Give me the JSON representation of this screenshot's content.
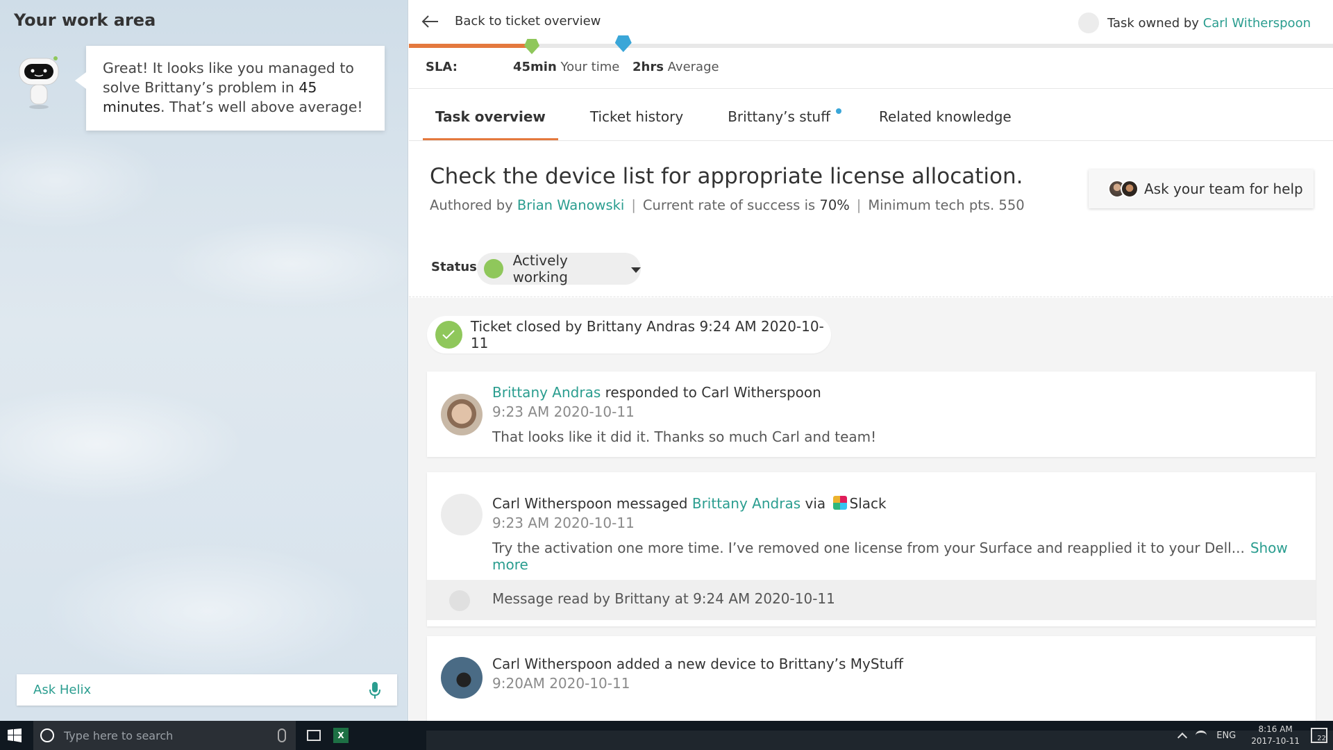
{
  "left": {
    "title": "Your work area",
    "bubble": {
      "pre": "Great! It looks like you managed to solve Brittany’s problem in ",
      "bold": "45 minutes",
      "post": ". That’s well above average!"
    },
    "ask_placeholder": "Ask Helix"
  },
  "topbar": {
    "back_label": "Back to ticket overview",
    "owner_prefix": "Task owned by",
    "owner_name": "Carl Witherspoon"
  },
  "sla": {
    "label": "SLA:",
    "your_value": "45min",
    "your_label": "Your time",
    "avg_value": "2hrs",
    "avg_label": "Average",
    "your_fraction": 0.133,
    "avg_fraction": 0.232
  },
  "tabs": [
    {
      "label": "Task overview",
      "active": true
    },
    {
      "label": "Ticket history"
    },
    {
      "label": "Brittany’s stuff",
      "has_dot": true
    },
    {
      "label": "Related knowledge"
    }
  ],
  "task": {
    "title": "Check the device list for appropriate license allocation.",
    "authored_prefix": "Authored by",
    "author": "Brian Wanowski",
    "success_prefix": "Current rate of success is",
    "success_value": "70%",
    "min_pts": "Minimum tech pts. 550",
    "help_label": "Ask your team for help"
  },
  "status": {
    "label": "Status",
    "value": "Actively working"
  },
  "feed": {
    "closed": "Ticket closed by Brittany Andras 9:24 AM 2020-10-11",
    "items": [
      {
        "actor": "Brittany Andras",
        "action": " responded to Carl Witherspoon",
        "time": "9:23 AM 2020-10-11",
        "body": "That looks like it did it. Thanks so much Carl and team!"
      },
      {
        "actor": "Carl Witherspoon messaged ",
        "target": "Brittany Andras",
        "via": " via ",
        "channel": "Slack",
        "time": "9:23 AM 2020-10-11",
        "body": "Try the activation one more time. I’ve removed one license from your Surface and reapplied it to your Dell...",
        "show_more": "Show more",
        "read_receipt": "Message read by Brittany at 9:24 AM 2020-10-11"
      },
      {
        "actor": "Carl Witherspoon added a new device to Brittany’s MyStuff",
        "time": "9:20AM 2020-10-11"
      }
    ]
  },
  "taskbar": {
    "search_placeholder": "Type here to search",
    "excel_label": "X",
    "lang": "ENG",
    "time": "8:16 AM",
    "date": "2017-10-11",
    "notif_count": "22"
  },
  "colors": {
    "accent": "#e4793e",
    "link": "#2a9d8f",
    "status_green": "#8fc75b",
    "sla_blue": "#3aa6d8"
  }
}
